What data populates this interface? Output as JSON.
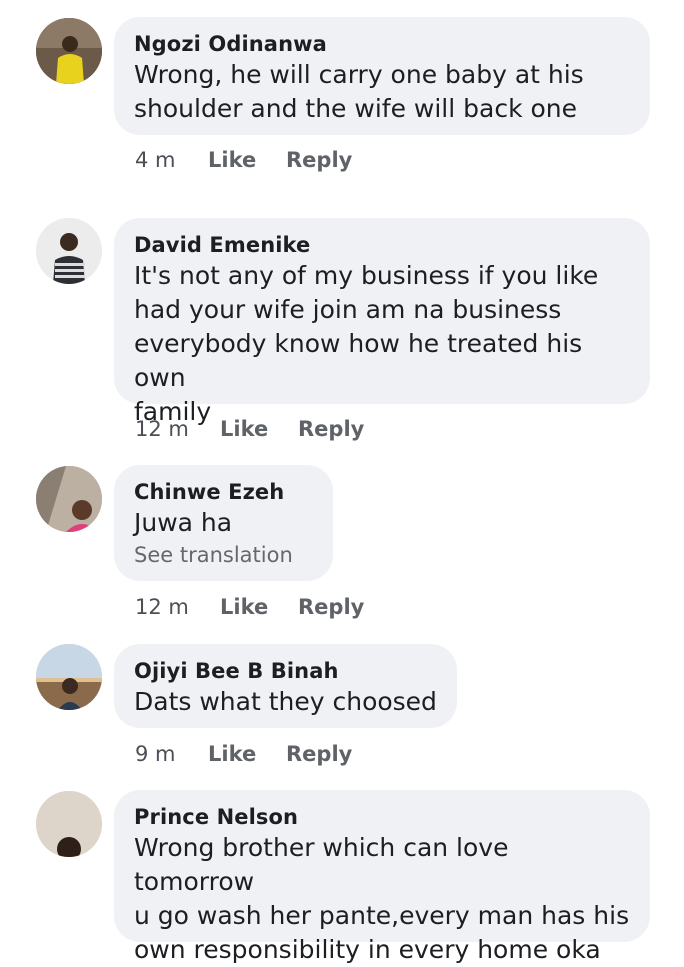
{
  "comments": [
    {
      "name": "Ngozi Odinanwa",
      "lines": [
        "Wrong, he will carry one baby at his",
        "shoulder and the wife will back one"
      ],
      "time": "4 m",
      "like": "Like",
      "reply": "Reply"
    },
    {
      "name": "David Emenike",
      "lines": [
        "It's not any of my business if you like",
        "had your wife join am  na business",
        "everybody know how he treated his own",
        "family"
      ],
      "time": "12 m",
      "like": "Like",
      "reply": "Reply"
    },
    {
      "name": "Chinwe Ezeh",
      "lines": [
        "Juwa ha"
      ],
      "see_translation": "See translation",
      "time": "12 m",
      "like": "Like",
      "reply": "Reply"
    },
    {
      "name": "Ojiyi Bee B Binah",
      "lines": [
        "Dats what they choosed"
      ],
      "time": "9 m",
      "like": "Like",
      "reply": "Reply"
    },
    {
      "name": "Prince Nelson",
      "lines": [
        "Wrong brother which can love tomorrow",
        "u go wash her pante,every man has his",
        "own responsibility in every home oka"
      ]
    }
  ]
}
